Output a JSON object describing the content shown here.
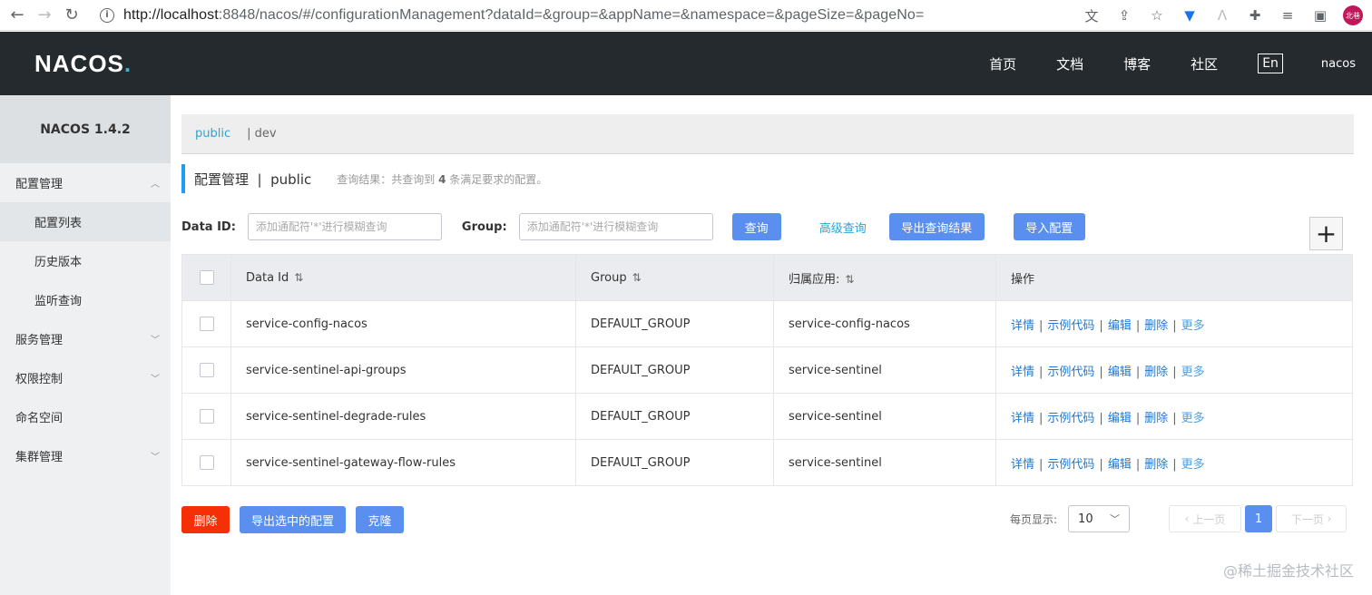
{
  "browser": {
    "url_host": "http://localhost",
    "url_rest": ":8848/nacos/#/configurationManagement?dataId=&group=&appName=&namespace=&pageSize=&pageNo=",
    "avatar_text": "北巷"
  },
  "header": {
    "logo_main": "NACOS",
    "logo_dot": ".",
    "nav": [
      "首页",
      "文档",
      "博客",
      "社区"
    ],
    "lang": "En",
    "user": "nacos"
  },
  "sidebar": {
    "title": "NACOS 1.4.2",
    "items": [
      {
        "label": "配置管理",
        "arrow": "︿"
      },
      {
        "label": "配置列表"
      },
      {
        "label": "历史版本"
      },
      {
        "label": "监听查询"
      },
      {
        "label": "服务管理",
        "arrow": "﹀"
      },
      {
        "label": "权限控制",
        "arrow": "﹀"
      },
      {
        "label": "命名空间"
      },
      {
        "label": "集群管理",
        "arrow": "﹀"
      }
    ]
  },
  "namespaces": {
    "active": "public",
    "other": "| dev"
  },
  "page_head": {
    "title": "配置管理  |  public",
    "query_prefix": "查询结果：共查询到",
    "query_count": "4",
    "query_suffix": "条满足要求的配置。"
  },
  "filter": {
    "dataid_label": "Data ID:",
    "dataid_placeholder": "添加通配符'*'进行模糊查询",
    "group_label": "Group:",
    "group_placeholder": "添加通配符'*'进行模糊查询",
    "query_btn": "查询",
    "advanced": "高级查询",
    "export_btn": "导出查询结果",
    "import_btn": "导入配置"
  },
  "table": {
    "headers": [
      "Data Id",
      "Group",
      "归属应用:",
      "操作"
    ],
    "ops": [
      "详情",
      "示例代码",
      "编辑",
      "删除",
      "更多"
    ],
    "rows": [
      {
        "data_id": "service-config-nacos",
        "group": "DEFAULT_GROUP",
        "app": "service-config-nacos"
      },
      {
        "data_id": "service-sentinel-api-groups",
        "group": "DEFAULT_GROUP",
        "app": "service-sentinel"
      },
      {
        "data_id": "service-sentinel-degrade-rules",
        "group": "DEFAULT_GROUP",
        "app": "service-sentinel"
      },
      {
        "data_id": "service-sentinel-gateway-flow-rules",
        "group": "DEFAULT_GROUP",
        "app": "service-sentinel"
      }
    ]
  },
  "bottom": {
    "delete_btn": "删除",
    "export_sel_btn": "导出选中的配置",
    "clone_btn": "克隆"
  },
  "pager": {
    "per_page_label": "每页显示:",
    "page_size": "10",
    "prev": "上一页",
    "current": "1",
    "next": "下一页"
  },
  "watermark": "@稀土掘金技术社区",
  "colors": {
    "header_bg": "#252a2f",
    "primary": "#5a8fef",
    "danger": "#f52f06",
    "link": "#2078d0",
    "accent": "#209bfa"
  }
}
